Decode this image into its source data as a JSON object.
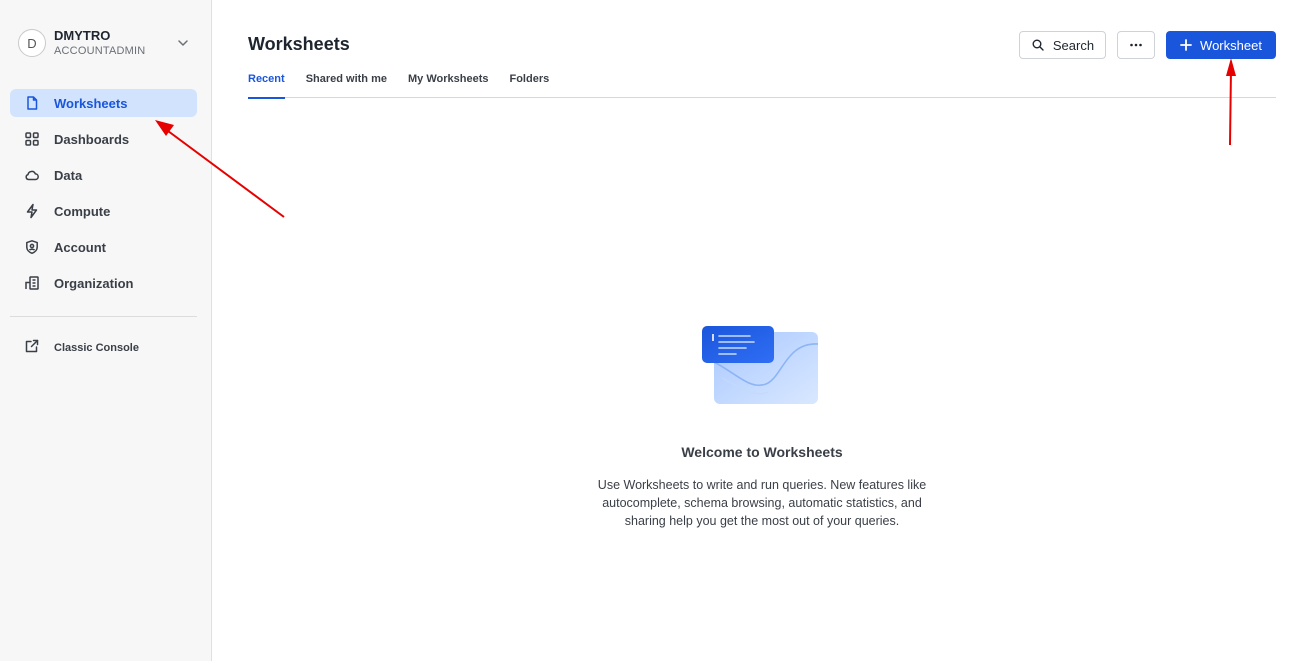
{
  "user": {
    "initial": "D",
    "name": "DMYTRO",
    "role": "ACCOUNTADMIN"
  },
  "sidebar": {
    "items": [
      {
        "label": "Worksheets",
        "icon": "document-icon",
        "active": true
      },
      {
        "label": "Dashboards",
        "icon": "grid-icon"
      },
      {
        "label": "Data",
        "icon": "cloud-icon"
      },
      {
        "label": "Compute",
        "icon": "lightning-icon"
      },
      {
        "label": "Account",
        "icon": "shield-user-icon"
      },
      {
        "label": "Organization",
        "icon": "building-icon"
      }
    ],
    "classic": {
      "label": "Classic Console",
      "icon": "external-link-icon"
    }
  },
  "header": {
    "title": "Worksheets",
    "search_label": "Search",
    "new_label": "Worksheet"
  },
  "tabs": [
    {
      "label": "Recent",
      "active": true
    },
    {
      "label": "Shared with me"
    },
    {
      "label": "My Worksheets"
    },
    {
      "label": "Folders"
    }
  ],
  "empty_state": {
    "title": "Welcome to Worksheets",
    "description": "Use Worksheets to write and run queries. New features like autocomplete, schema browsing, automatic statistics, and sharing help you get the most out of your queries."
  },
  "colors": {
    "accent": "#1a56db",
    "active_bg": "#d1e3fd",
    "annotation": "#e60000"
  }
}
